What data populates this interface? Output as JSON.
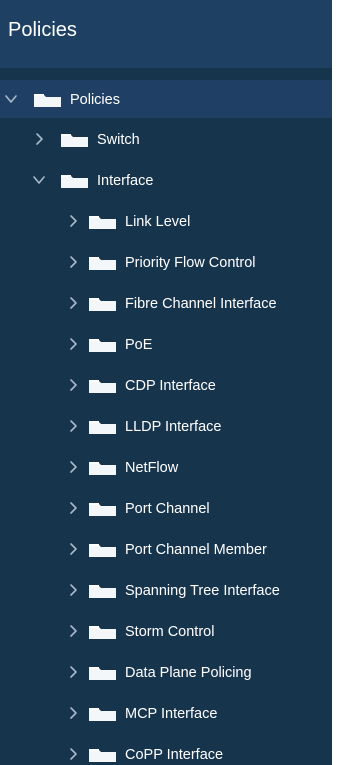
{
  "header": {
    "title": "Policies"
  },
  "icons": {
    "expanded": "chevron-down-icon",
    "collapsed": "chevron-right-icon",
    "folder": "folder-icon"
  },
  "colors": {
    "sidebar_background": "#17344d",
    "header_background": "#1e4163",
    "selected_row_background": "#1f4064",
    "text": "#ffffff",
    "folder": "#f4f7fa",
    "chevron": "#a9b9c9"
  },
  "tree": {
    "root": {
      "label": "Policies",
      "expanded": true
    },
    "switch": {
      "label": "Switch",
      "expanded": false
    },
    "interface": {
      "label": "Interface",
      "expanded": true
    },
    "interface_children": [
      {
        "label": "Link Level",
        "expanded": false
      },
      {
        "label": "Priority Flow Control",
        "expanded": false
      },
      {
        "label": "Fibre Channel Interface",
        "expanded": false
      },
      {
        "label": "PoE",
        "expanded": false
      },
      {
        "label": "CDP Interface",
        "expanded": false
      },
      {
        "label": "LLDP Interface",
        "expanded": false
      },
      {
        "label": "NetFlow",
        "expanded": false
      },
      {
        "label": "Port Channel",
        "expanded": false
      },
      {
        "label": "Port Channel Member",
        "expanded": false
      },
      {
        "label": "Spanning Tree Interface",
        "expanded": false
      },
      {
        "label": "Storm Control",
        "expanded": false
      },
      {
        "label": "Data Plane Policing",
        "expanded": false
      },
      {
        "label": "MCP Interface",
        "expanded": false
      },
      {
        "label": "CoPP Interface",
        "expanded": false
      }
    ]
  }
}
